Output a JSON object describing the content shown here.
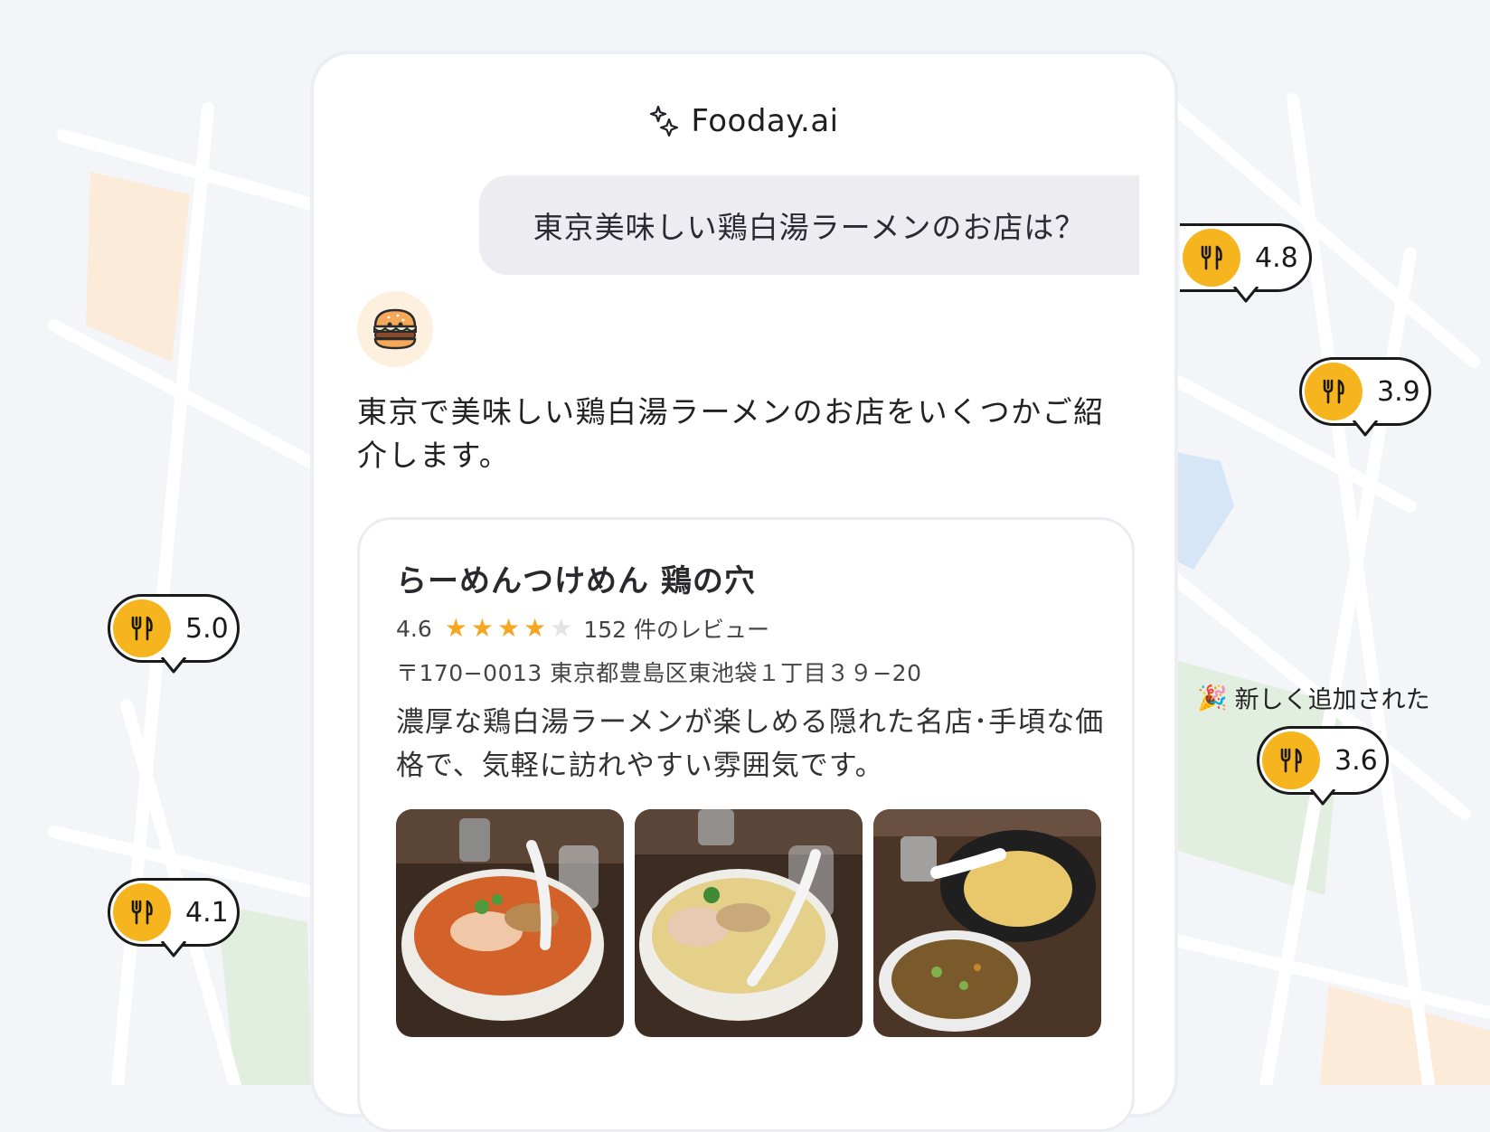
{
  "app": {
    "title": "Fooday.ai",
    "sparkle_icon": "sparkle-icon"
  },
  "chat": {
    "user_message": "東京美味しい鶏白湯ラーメンのお店は？",
    "bot_avatar_icon": "burger-icon",
    "bot_message": "東京で美味しい鶏白湯ラーメンのお店をいくつかご紹介します。"
  },
  "restaurant": {
    "name": "らーめんつけめん 鶏の穴",
    "rating": "4.6",
    "stars_filled": 4,
    "stars_total": 5,
    "reviews": "152 件のレビュー",
    "address": "〒170−0013 東京都豊島区東池袋１丁目３９−20",
    "description": "濃厚な鶏白湯ラーメンが楽しめる隠れた名店･手頃な価格で、気軽に訪れやすい雰囲気です。",
    "photos": [
      "spicy-ramen-photo",
      "paitan-ramen-photo",
      "tsukemen-photo"
    ]
  },
  "map_pins": [
    {
      "value": "4.8"
    },
    {
      "value": "3.9"
    },
    {
      "value": "5.0"
    },
    {
      "value": "3.6"
    },
    {
      "value": "4.1"
    }
  ],
  "new_label": {
    "emoji": "🎉",
    "text": "新しく追加された"
  },
  "colors": {
    "accent": "#f6b51e",
    "star": "#f5a623",
    "star_empty": "#e3e3e8",
    "bubble": "#ececf1"
  }
}
